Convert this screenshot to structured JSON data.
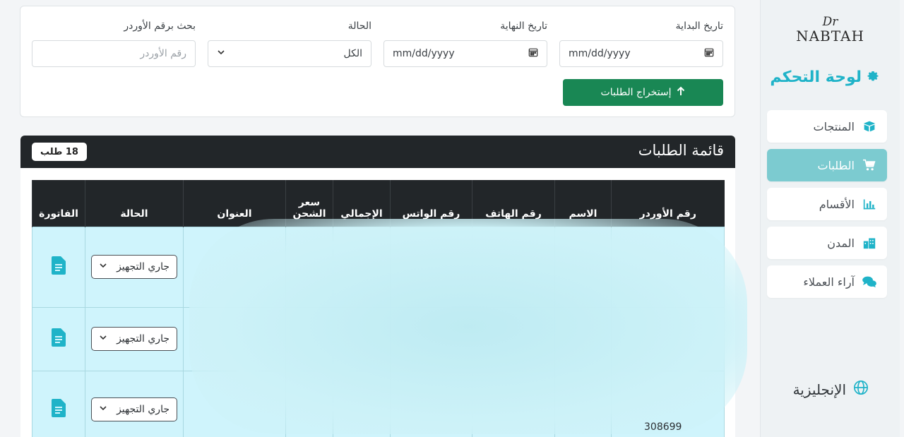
{
  "sidebar": {
    "logo_sig": "Dr",
    "logo_name": "NABTAH",
    "dashboard_title": "لوحة التحكم",
    "items": [
      {
        "label": "المنتجات",
        "icon": "box-icon",
        "active": false
      },
      {
        "label": "الطلبات",
        "icon": "cart-icon",
        "active": true
      },
      {
        "label": "الأقسام",
        "icon": "chart-icon",
        "active": false
      },
      {
        "label": "المدن",
        "icon": "city-icon",
        "active": false
      },
      {
        "label": "آراء العملاء",
        "icon": "chat-icon",
        "active": false
      }
    ],
    "language_label": "الإنجليزية"
  },
  "filters": {
    "start_date_label": "تاريخ البداية",
    "start_date_value": "mm/dd/yyyy",
    "end_date_label": "تاريخ النهاية",
    "end_date_value": "mm/dd/yyyy",
    "status_label": "الحالة",
    "status_value": "الكل",
    "order_search_label": "بحث برقم الأوردر",
    "order_search_placeholder": "رقم الأوردر",
    "export_button": "إستخراج الطلبات"
  },
  "orders": {
    "title": "قائمة الطلبات",
    "count_badge": "18 طلب",
    "columns": [
      "رقم الأوردر",
      "الاسم",
      "رقم الهاتف",
      "رقم الواتس",
      "الإجمالي",
      "سعر الشحن",
      "العنوان",
      "الحالة",
      "الفاتورة"
    ],
    "rows": [
      {
        "status": "جاري التجهيز"
      },
      {
        "status": "جاري التجهيز"
      },
      {
        "status": "جاري التجهيز",
        "order_no": "308699"
      }
    ]
  },
  "colors": {
    "accent": "#1fb3c8",
    "active_nav": "#7ccbd0",
    "export_button": "#198754",
    "table_header": "#222629",
    "row_bg": "#cff4fc"
  }
}
